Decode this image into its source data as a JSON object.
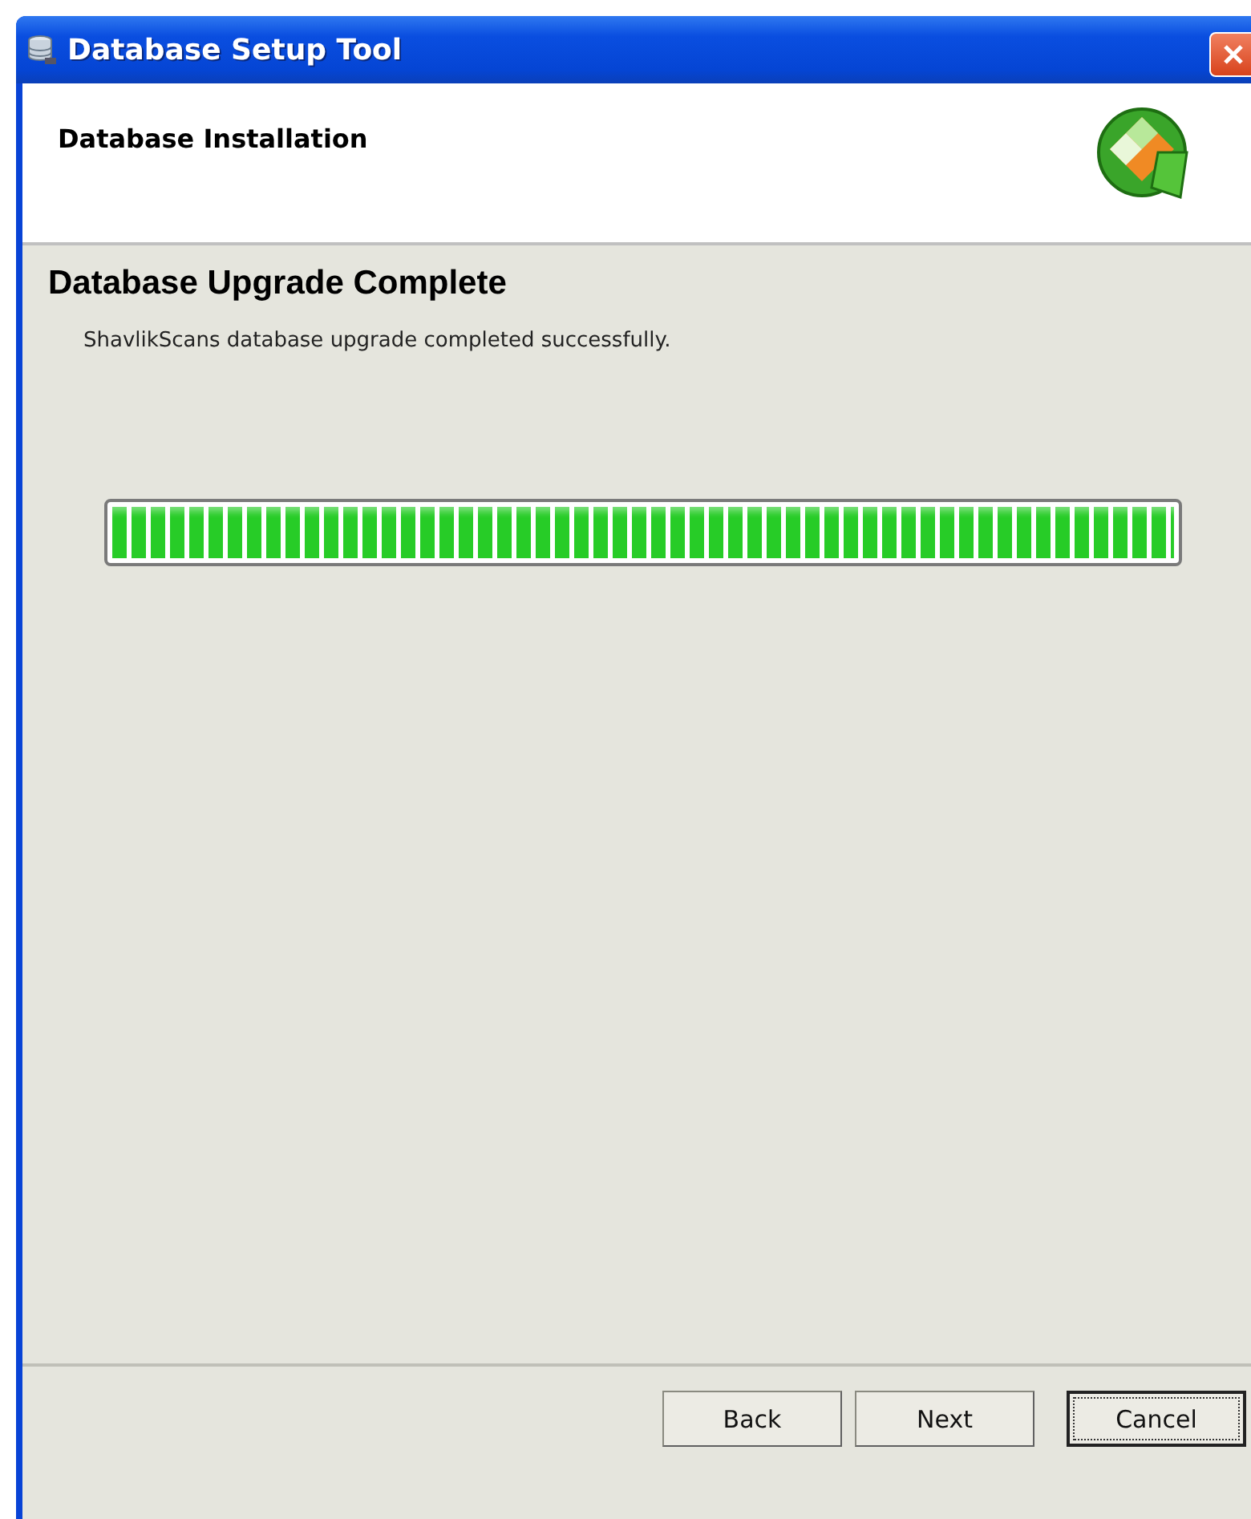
{
  "window": {
    "title": "Database Setup Tool"
  },
  "header": {
    "title": "Database Installation"
  },
  "page": {
    "heading": "Database Upgrade Complete",
    "message": "ShavlikScans database upgrade completed successfully."
  },
  "progress": {
    "level": 1
  },
  "buttons": [
    {
      "label": "Back",
      "default": false
    },
    {
      "label": "Next",
      "default": false
    },
    {
      "label": "Cancel",
      "default": true
    }
  ]
}
